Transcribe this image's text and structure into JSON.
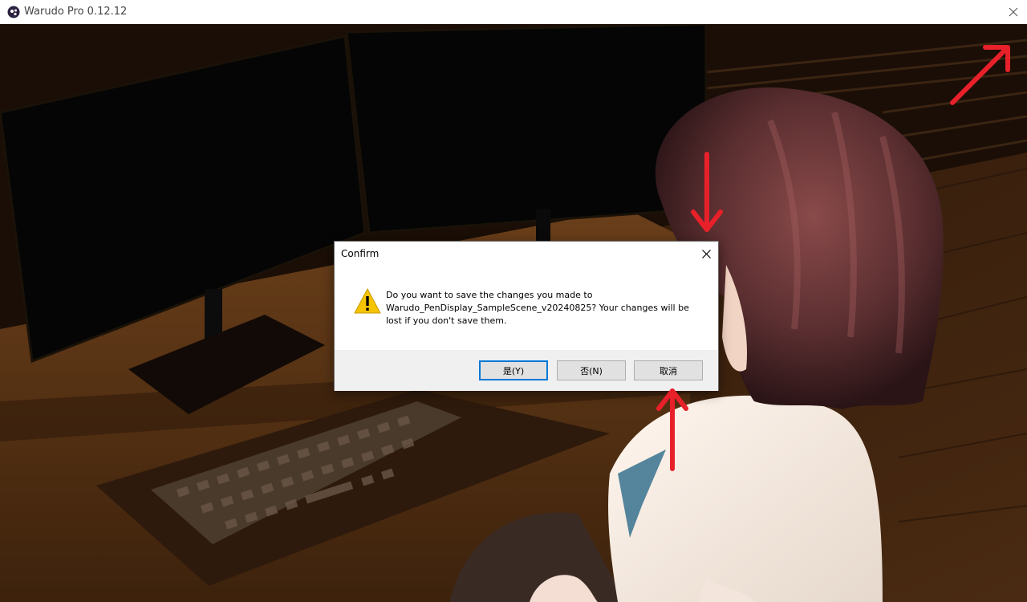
{
  "window": {
    "title": "Warudo Pro 0.12.12",
    "icon": "warudo-logo-icon",
    "close_icon": "close-icon"
  },
  "dialog": {
    "title": "Confirm",
    "icon": "warning-icon",
    "message": "Do you want to save the changes you made to Warudo_PenDisplay_SampleScene_v20240825? Your changes will be lost if you don't save them.",
    "buttons": {
      "yes": "是(Y)",
      "no": "否(N)",
      "cancel": "取消"
    },
    "default_button": "yes"
  },
  "annotations": {
    "arrow_color": "#e8202a",
    "arrows": [
      "arrow-to-window-close",
      "arrow-to-dialog-close",
      "arrow-to-cancel-button"
    ]
  },
  "colors": {
    "accent": "#0078d7",
    "warning": "#f5c400",
    "button_bg": "#e1e1e1",
    "button_area_bg": "#f0f0f0"
  }
}
